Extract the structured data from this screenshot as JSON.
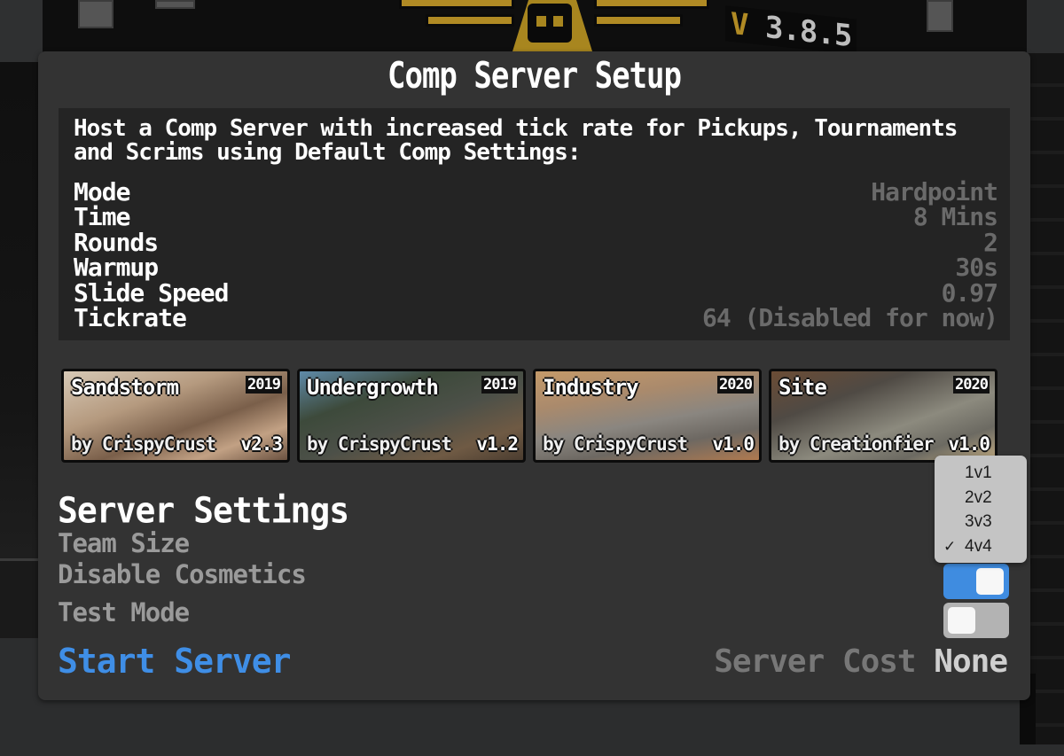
{
  "background": {
    "version_prefix": "V",
    "version_number": "3.8.5"
  },
  "panel": {
    "title": "Comp Server Setup",
    "description": "Host a Comp Server with increased tick rate for Pickups, Tournaments and Scrims using Default Comp Settings:",
    "settings": [
      {
        "key": "Mode",
        "value": "Hardpoint"
      },
      {
        "key": "Time",
        "value": "8 Mins"
      },
      {
        "key": "Rounds",
        "value": "2"
      },
      {
        "key": "Warmup",
        "value": "30s"
      },
      {
        "key": "Slide Speed",
        "value": "0.97"
      },
      {
        "key": "Tickrate",
        "value": "64 (Disabled for now)"
      }
    ],
    "maps": [
      {
        "name": "Sandstorm",
        "year": "2019",
        "author": "by CrispyCrust",
        "version": "v2.3"
      },
      {
        "name": "Undergrowth",
        "year": "2019",
        "author": "by CrispyCrust",
        "version": "v1.2"
      },
      {
        "name": "Industry",
        "year": "2020",
        "author": "by CrispyCrust",
        "version": "v1.0"
      },
      {
        "name": "Site",
        "year": "2020",
        "author": "by Creationfier",
        "version": "v1.0"
      }
    ],
    "server_settings": {
      "title": "Server Settings",
      "team_size_label": "Team Size",
      "team_size_options": [
        {
          "label": "1v1",
          "selected": false
        },
        {
          "label": "2v2",
          "selected": false
        },
        {
          "label": "3v3",
          "selected": false
        },
        {
          "label": "4v4",
          "selected": true
        }
      ],
      "check_mark": "✓",
      "disable_cosmetics_label": "Disable Cosmetics",
      "disable_cosmetics_on": true,
      "test_mode_label": "Test Mode",
      "test_mode_on": false
    },
    "start_server_label": "Start Server",
    "server_cost_label": "Server Cost",
    "server_cost_value": "None"
  },
  "colors": {
    "accent_blue": "#3f8ee6",
    "toggle_on": "#3f8ce0",
    "toggle_off": "#b3b3b3",
    "panel_bg": "#333333",
    "info_bg": "#242424",
    "logo_gold": "#b08a24"
  }
}
